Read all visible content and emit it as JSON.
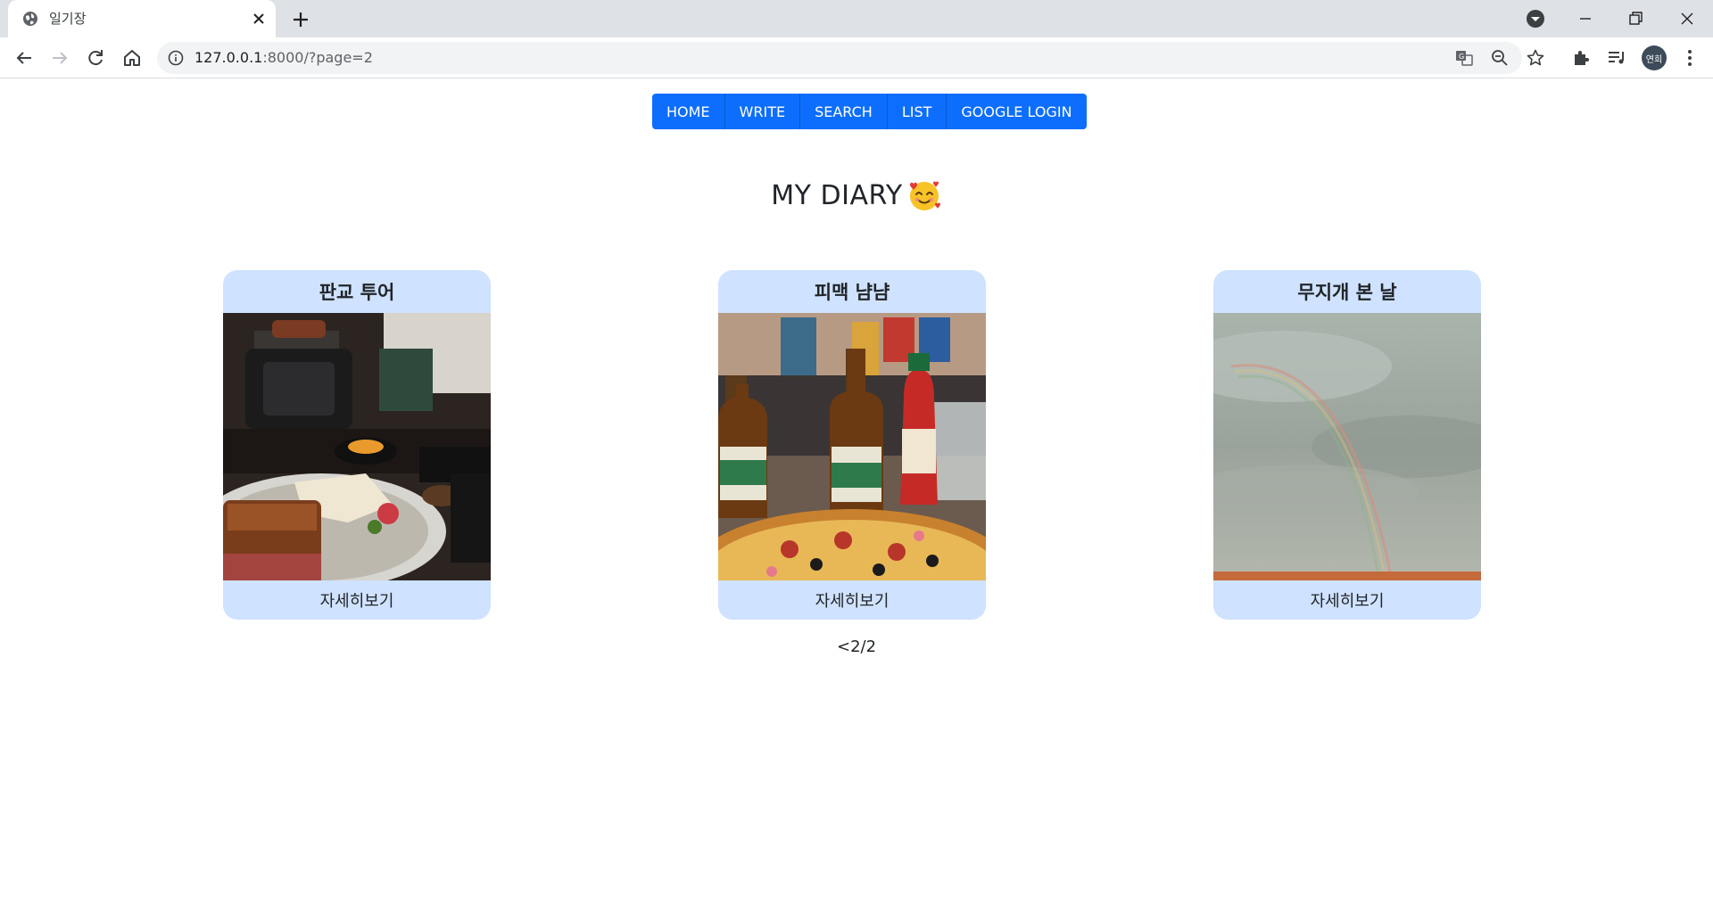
{
  "browser": {
    "tab_title": "일기장",
    "url_host": "127.0.0.1",
    "url_rest": ":8000/?page=2",
    "profile_initials": "연희"
  },
  "nav": {
    "items": [
      "HOME",
      "WRITE",
      "SEARCH",
      "LIST",
      "GOOGLE LOGIN"
    ]
  },
  "page_title": "MY DIARY",
  "cards": [
    {
      "title": "판교 투어",
      "link": "자세히보기",
      "photo": "pork-cutlet-meal"
    },
    {
      "title": "피맥 냠냠",
      "link": "자세히보기",
      "photo": "pizza-and-beer"
    },
    {
      "title": "무지개 본 날",
      "link": "자세히보기",
      "photo": "rainbow-sky"
    }
  ],
  "pager": {
    "prev": "<",
    "current": "2/2"
  },
  "colors": {
    "nav_button": "#0d6efd",
    "card_bg": "#cfe2ff",
    "tabstrip": "#dee1e6"
  }
}
